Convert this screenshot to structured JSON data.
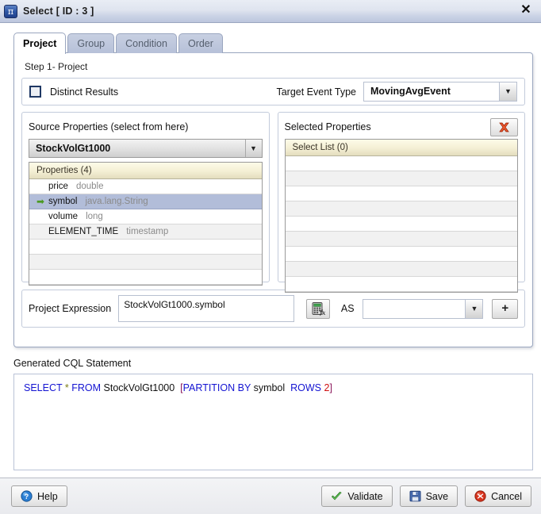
{
  "window": {
    "title": "Select [ ID : 3 ]",
    "icon": "pi-projection-icon",
    "icon_glyph": "π",
    "close_label": "✕"
  },
  "tabs": [
    {
      "label": "Project",
      "active": true
    },
    {
      "label": "Group",
      "active": false
    },
    {
      "label": "Condition",
      "active": false
    },
    {
      "label": "Order",
      "active": false
    }
  ],
  "project": {
    "step_label": "Step 1- Project",
    "distinct": {
      "label": "Distinct Results",
      "checked": false
    },
    "target_event_type": {
      "label": "Target Event Type",
      "value": "MovingAvgEvent",
      "arrow": "▼"
    },
    "source_panel": {
      "title": "Source Properties (select from here)",
      "source_value": "StockVolGt1000",
      "source_arrow": "▼",
      "table_header": "Properties (4)",
      "rows": [
        {
          "name": "price",
          "type": "double",
          "selected": false
        },
        {
          "name": "symbol",
          "type": "java.lang.String",
          "selected": true
        },
        {
          "name": "volume",
          "type": "long",
          "selected": false
        },
        {
          "name": "ELEMENT_TIME",
          "type": "timestamp",
          "selected": false
        }
      ],
      "empty_row_count": 3,
      "selected_marker": "➡"
    },
    "selected_panel": {
      "title": "Selected Properties",
      "delete_button_name": "delete-selected-property",
      "table_header": "Select List (0)",
      "rows": [],
      "empty_row_count": 9
    },
    "expression": {
      "label": "Project Expression",
      "value": "StockVolGt1000.symbol",
      "fx_button_name": "expression-builder",
      "as_label": "AS",
      "as_value": "",
      "as_placeholder": "",
      "as_arrow": "▼",
      "add_label": "+"
    }
  },
  "cql": {
    "label": "Generated CQL Statement",
    "tokens": [
      {
        "text": "SELECT",
        "kind": "kw"
      },
      {
        "text": " ",
        "kind": "plain"
      },
      {
        "text": "*",
        "kind": "star"
      },
      {
        "text": " ",
        "kind": "plain"
      },
      {
        "text": "FROM",
        "kind": "kw"
      },
      {
        "text": " ",
        "kind": "plain"
      },
      {
        "text": "StockVolGt1000",
        "kind": "ident"
      },
      {
        "text": "  ",
        "kind": "plain"
      },
      {
        "text": "[",
        "kind": "brk"
      },
      {
        "text": "PARTITION BY",
        "kind": "kw"
      },
      {
        "text": " ",
        "kind": "plain"
      },
      {
        "text": "symbol",
        "kind": "ident"
      },
      {
        "text": "  ",
        "kind": "plain"
      },
      {
        "text": "ROWS",
        "kind": "kw"
      },
      {
        "text": " ",
        "kind": "plain"
      },
      {
        "text": "2",
        "kind": "num"
      },
      {
        "text": "]",
        "kind": "brk"
      }
    ],
    "plain_text": "SELECT * FROM StockVolGt1000  [PARTITION BY symbol  ROWS 2]"
  },
  "footer": {
    "help": "Help",
    "validate": "Validate",
    "save": "Save",
    "cancel": "Cancel"
  },
  "colors": {
    "titlebar_accent": "#bcc6dd",
    "selected_row": "#b2bdd9",
    "table_header": "#f4efd4",
    "keyword_blue": "#1414d2",
    "number_red": "#d01010",
    "bracket_magenta": "#8b1a5c",
    "star_olive": "#7d7d16",
    "check_green": "#4a9a22",
    "delete_red": "#d8341f"
  }
}
